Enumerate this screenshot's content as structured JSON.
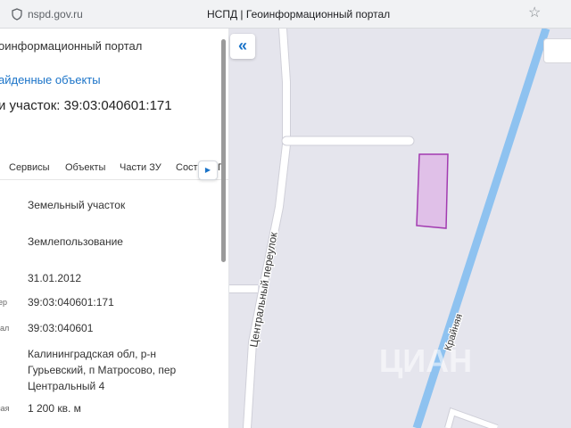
{
  "browser": {
    "url": "nspd.gov.ru",
    "title": "НСПД | Геоинформационный портал"
  },
  "panel": {
    "portal_name": "оинформационный портал",
    "found_link": "айденные объекты",
    "parcel_title": "и участок: 39:03:040601:171",
    "tabs": [
      "Сервисы",
      "Объекты",
      "Части ЗУ",
      "Соста",
      "Г"
    ],
    "rows": [
      {
        "label": "",
        "value": "Земельный участок"
      },
      {
        "label": "",
        "value": "Землепользование"
      },
      {
        "label": "",
        "value": "31.01.2012"
      },
      {
        "label": "ер",
        "value": "39:03:040601:171"
      },
      {
        "label": "тал",
        "value": "39:03:040601"
      },
      {
        "label": "",
        "value_lines": [
          "Калининградская обл, р-н",
          "Гурьевский, п Матросово, пер",
          "Центральный 4"
        ]
      },
      {
        "label": "вая",
        "value": "1 200 кв. м"
      }
    ]
  },
  "map": {
    "street_central": "Центральный переулок",
    "street_krainyaya": "Крайняя",
    "watermark": "ЦИАН",
    "colors": {
      "background": "#e5e5ed",
      "road": "#ffffff",
      "road_outline": "#d0d0d8",
      "river": "#8ec2f0",
      "parcel_fill": "#e0c0e8",
      "parcel_stroke": "#a23ab0"
    }
  }
}
